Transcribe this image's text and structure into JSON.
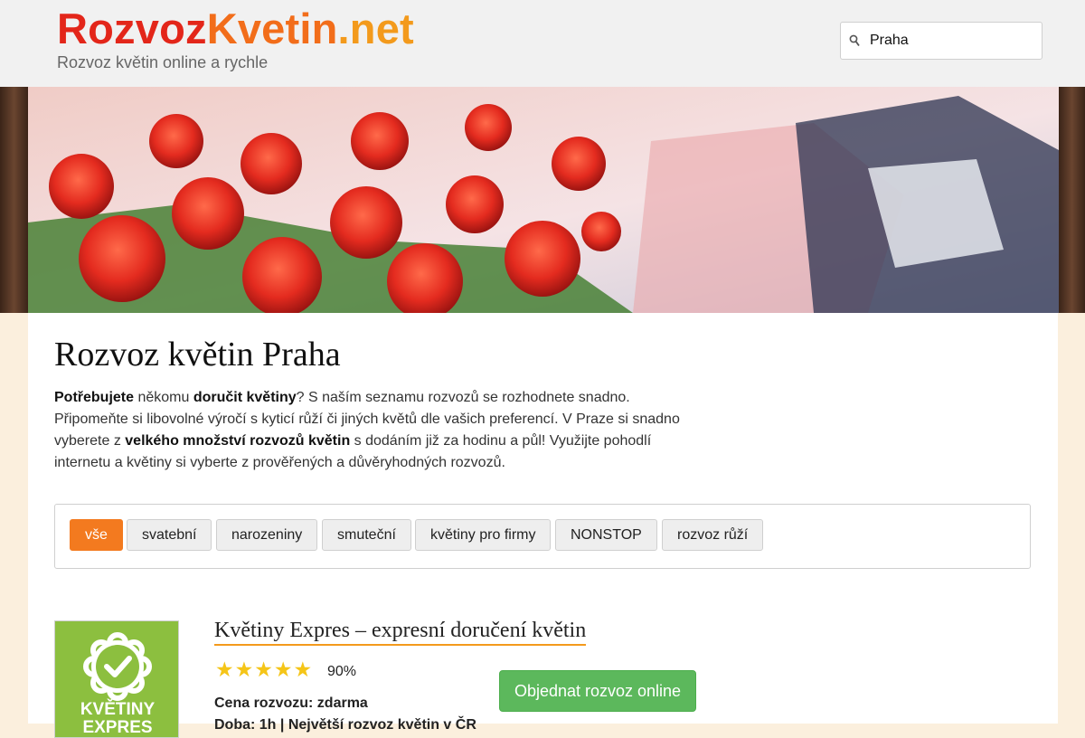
{
  "header": {
    "logo_part1": "Rozvoz",
    "logo_part2": "Kvetin",
    "logo_part3": ".net",
    "tagline": "Rozvoz květin online a rychle",
    "search_value": "Praha",
    "search_icon": "search-icon"
  },
  "colors": {
    "logo_red": "#e3261a",
    "logo_orange": "#f26d1a",
    "accent_orange": "#f37a1f",
    "order_green": "#5cb85c",
    "page_bg": "#fbefdd"
  },
  "main": {
    "title": "Rozvoz květin Praha",
    "intro": {
      "p1_bold": "Potřebujete",
      "p1": " někomu ",
      "p2_bold": "doručit květiny",
      "p2": "? S naším seznamu rozvozů se rozhodnete snadno. Připomeňte si libovolné výročí s kyticí růží či jiných květů dle vašich preferencí. V Praze si snadno vyberete z ",
      "p3_bold": "velkého množství rozvozů květin",
      "p3": " s dodáním již za hodinu a půl! Využijte pohodlí internetu a květiny si vyberte z prověřených a důvěryhodných rozvozů."
    },
    "filters": [
      {
        "label": "vše",
        "active": true
      },
      {
        "label": "svatební",
        "active": false
      },
      {
        "label": "narozeniny",
        "active": false
      },
      {
        "label": "smuteční",
        "active": false
      },
      {
        "label": "květiny pro firmy",
        "active": false
      },
      {
        "label": "NONSTOP",
        "active": false
      },
      {
        "label": "rozvoz růží",
        "active": false
      }
    ]
  },
  "listing": {
    "logo_text1": "KVĚTINY",
    "logo_text2": "EXPRES",
    "title": "Květiny Expres – expresní doručení květin",
    "stars": "★★★★★",
    "rating": 90,
    "rating_label": "90%",
    "price": "Cena rozvozu: zdarma",
    "delivery": "Doba: 1h | Největší rozvoz květin v ČR",
    "order_label": "Objednat rozvoz online"
  }
}
